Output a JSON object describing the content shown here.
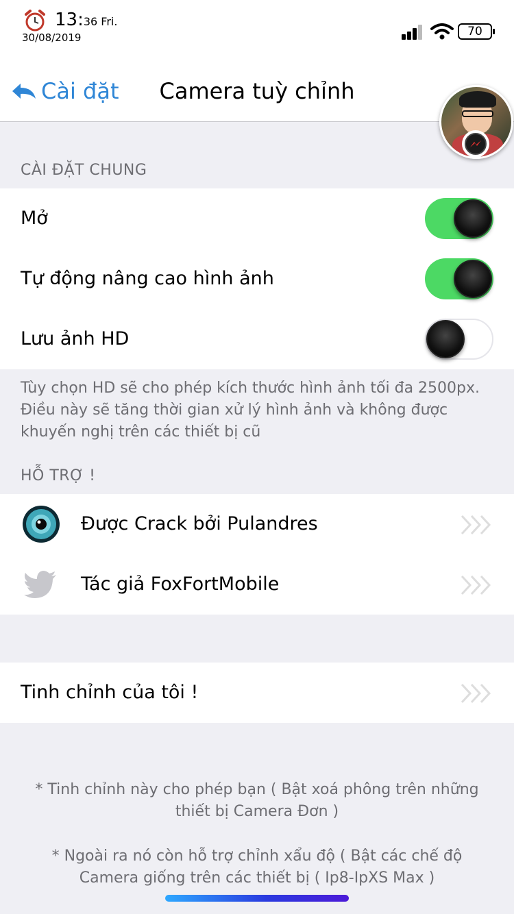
{
  "status_bar": {
    "time_main": "13:",
    "time_small": "36 Fri.",
    "date": "30/08/2019",
    "battery": "70"
  },
  "nav": {
    "back_label": "Cài đặt",
    "title": "Camera tuỳ chỉnh"
  },
  "general": {
    "header": "CÀI ĐẶT CHUNG",
    "rows": [
      {
        "label": "Mở",
        "on": true
      },
      {
        "label": "Tự động nâng cao hình ảnh",
        "on": true
      },
      {
        "label": "Lưu ảnh HD",
        "on": false
      }
    ],
    "note": "Tùy chọn HD sẽ cho phép kích thước hình ảnh tối đa 2500px.  Điều này sẽ tăng thời gian xử lý hình ảnh và không được khuyến nghị trên các thiết bị cũ"
  },
  "support": {
    "header": "HỖ TRỢ !",
    "items": [
      {
        "label": "Được Crack bởi Pulandres",
        "icon": "eye-icon"
      },
      {
        "label": "Tác giả FoxFortMobile",
        "icon": "twitter-bird-icon"
      }
    ]
  },
  "tweaks": {
    "label": "Tinh chỉnh của tôi !"
  },
  "notes": {
    "line1": "* Tinh chỉnh này cho phép bạn ( Bật xoá phông trên những thiết bị Camera Đơn )",
    "line2": "* Ngoài ra nó còn hỗ trợ chỉnh xẩu độ ( Bật các chế độ Camera giống trên các thiết bị ( Ip8-IpXS Max )"
  },
  "colors": {
    "accent": "#2f86d6",
    "toggle_on": "#4cd964",
    "background": "#efeff4"
  }
}
